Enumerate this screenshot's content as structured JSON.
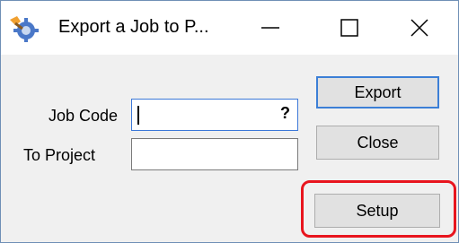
{
  "window": {
    "title": "Export a Job to P...",
    "app_icon": "wrench-gear-icon"
  },
  "caption_buttons": {
    "minimize_icon": "minimize-icon",
    "maximize_icon": "maximize-icon",
    "close_icon": "close-icon"
  },
  "form": {
    "job_code_label": "Job Code",
    "job_code_value": "",
    "lookup_glyph": "?",
    "to_project_label": "To Project",
    "to_project_value": ""
  },
  "buttons": {
    "export_label": "Export",
    "close_label": "Close",
    "setup_label": "Setup"
  },
  "colors": {
    "focus_border": "#3c7fd6",
    "highlight": "#e8151e"
  }
}
